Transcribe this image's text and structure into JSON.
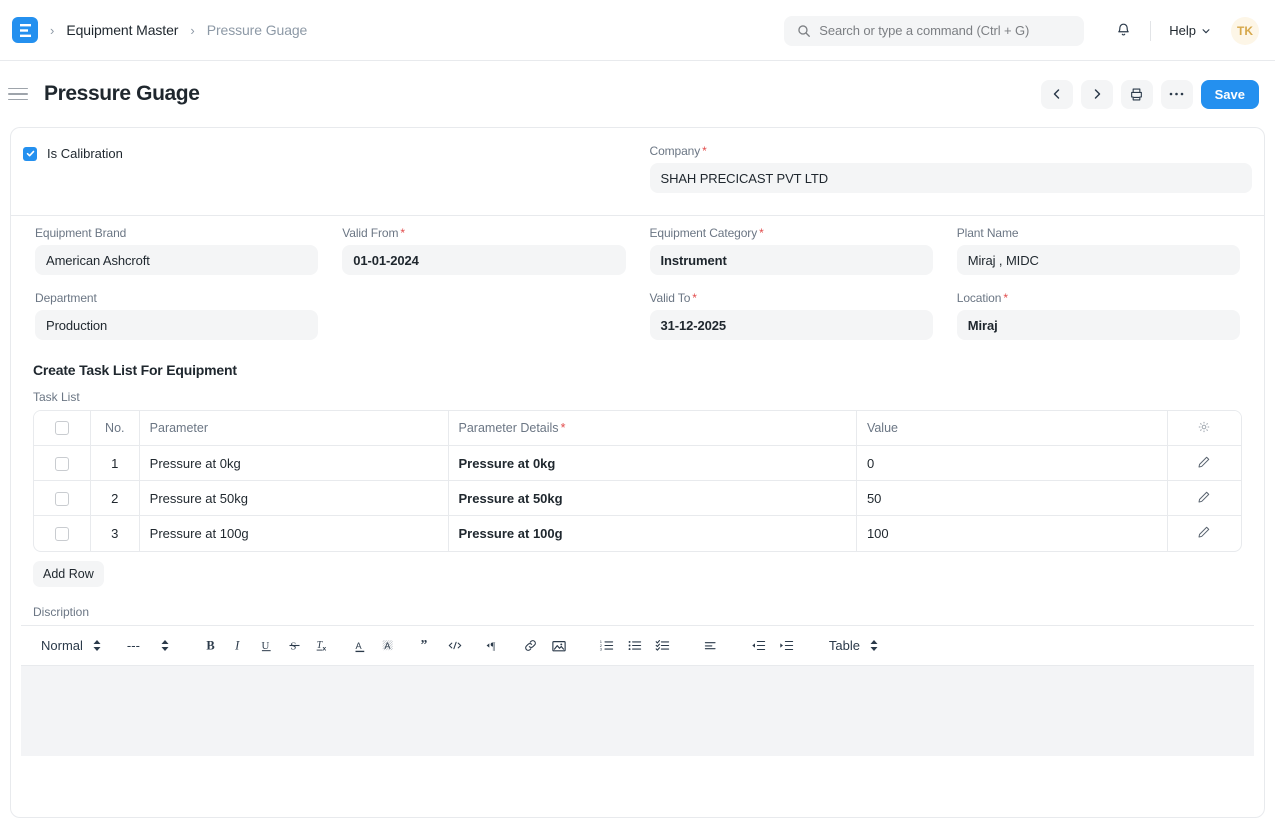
{
  "navbar": {
    "logo_text": "E",
    "logo_icon": "erpnext-logo-icon",
    "breadcrumbs": [
      {
        "label": "Equipment Master",
        "muted": false
      },
      {
        "label": "Pressure Guage",
        "muted": true
      }
    ],
    "search": {
      "placeholder": "Search or type a command (Ctrl + G)",
      "value": "",
      "icon": "search-icon"
    },
    "notifications_icon": "bell-icon",
    "help": {
      "label": "Help",
      "icon": "chevron-down-icon"
    },
    "avatar_initials": "TK"
  },
  "page_header": {
    "title": "Pressure Guage",
    "menu_icon": "hamburger-icon",
    "actions": [
      {
        "name": "prev",
        "icon": "chevron-left-icon"
      },
      {
        "name": "next",
        "icon": "chevron-right-icon"
      },
      {
        "name": "print",
        "icon": "printer-icon"
      },
      {
        "name": "more",
        "icon": "ellipsis-icon"
      }
    ],
    "save_label": "Save"
  },
  "form": {
    "is_calibration": {
      "label": "Is Calibration",
      "checked": true
    },
    "company": {
      "label": "Company",
      "required": true,
      "value": "SHAH PRECICAST PVT LTD"
    },
    "equipment_brand": {
      "label": "Equipment Brand",
      "required": false,
      "value": "American Ashcroft"
    },
    "valid_from": {
      "label": "Valid From",
      "required": true,
      "value": "01-01-2024"
    },
    "equipment_category": {
      "label": "Equipment Category",
      "required": true,
      "value": "Instrument"
    },
    "plant_name": {
      "label": "Plant Name",
      "required": false,
      "value": "Miraj , MIDC"
    },
    "department": {
      "label": "Department",
      "required": false,
      "value": "Production"
    },
    "valid_to": {
      "label": "Valid To",
      "required": true,
      "value": "31-12-2025"
    },
    "location": {
      "label": "Location",
      "required": true,
      "value": "Miraj"
    }
  },
  "task_section": {
    "title": "Create Task List For Equipment",
    "table_label": "Task List",
    "columns": [
      {
        "key": "no",
        "label": "No.",
        "required": false
      },
      {
        "key": "parameter",
        "label": "Parameter",
        "required": false
      },
      {
        "key": "parameter_details",
        "label": "Parameter Details",
        "required": true
      },
      {
        "key": "value",
        "label": "Value",
        "required": false
      }
    ],
    "settings_icon": "gear-icon",
    "rows": [
      {
        "no": "1",
        "parameter": "Pressure at 0kg",
        "parameter_details": "Pressure at 0kg",
        "value": "0",
        "edit_icon": "pencil-icon"
      },
      {
        "no": "2",
        "parameter": "Pressure at 50kg",
        "parameter_details": "Pressure at 50kg",
        "value": "50",
        "edit_icon": "pencil-icon"
      },
      {
        "no": "3",
        "parameter": "Pressure at 100g",
        "parameter_details": "Pressure at 100g",
        "value": "100",
        "edit_icon": "pencil-icon"
      }
    ],
    "add_row_label": "Add Row"
  },
  "editor": {
    "label": "Discription",
    "style_select": "Normal",
    "font_select": "---",
    "table_select": "Table",
    "content": "",
    "tools": [
      "bold-icon",
      "italic-icon",
      "underline-icon",
      "strikethrough-icon",
      "clear-format-icon",
      "text-color-icon",
      "highlight-color-icon",
      "blockquote-icon",
      "code-block-icon",
      "paragraph-direction-icon",
      "link-icon",
      "image-icon",
      "ordered-list-icon",
      "bullet-list-icon",
      "checklist-icon",
      "align-icon",
      "outdent-icon",
      "indent-icon"
    ]
  },
  "colors": {
    "accent": "#2490ef",
    "required": "#e24c4c",
    "muted_text": "#6b7684",
    "field_bg": "#f4f5f6",
    "border": "#e8eaed",
    "avatar_bg": "#fdf6e7",
    "avatar_fg": "#d6a84b"
  }
}
